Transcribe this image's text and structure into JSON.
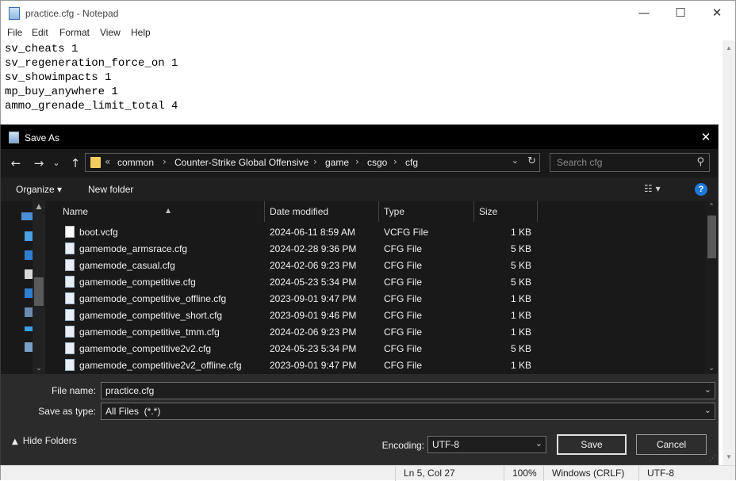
{
  "notepad": {
    "title": "practice.cfg - Notepad",
    "controls": {
      "minimize": "—",
      "maximize": "☐",
      "close": "✕"
    },
    "menu": [
      "File",
      "Edit",
      "Format",
      "View",
      "Help"
    ],
    "lines": [
      "sv_cheats 1",
      "sv_regeneration_force_on 1",
      "sv_showimpacts 1",
      "mp_buy_anywhere 1",
      "ammo_grenade_limit_total 4"
    ],
    "status": {
      "position": "Ln 5, Col 27",
      "zoom": "100%",
      "line_endings": "Windows (CRLF)",
      "encoding": "UTF-8"
    }
  },
  "dialog": {
    "title": "Save As",
    "close_glyph": "✕",
    "nav": {
      "back": "←",
      "forward": "→",
      "recent": "⌄",
      "up": "↑"
    },
    "address": {
      "overflow": "«",
      "crumbs": [
        "common",
        "Counter-Strike Global Offensive",
        "game",
        "csgo",
        "cfg"
      ]
    },
    "search_placeholder": "Search cfg",
    "toolbar": {
      "organize": "Organize ▾",
      "new_folder": "New folder",
      "help": "?"
    },
    "columns": {
      "name": "Name",
      "date": "Date modified",
      "type": "Type",
      "size": "Size"
    },
    "files": [
      {
        "name": "boot.vcfg",
        "date": "2024-06-11 8:59 AM",
        "type": "VCFG File",
        "size": "1 KB"
      },
      {
        "name": "gamemode_armsrace.cfg",
        "date": "2024-02-28 9:36 PM",
        "type": "CFG File",
        "size": "5 KB"
      },
      {
        "name": "gamemode_casual.cfg",
        "date": "2024-02-06 9:23 PM",
        "type": "CFG File",
        "size": "5 KB"
      },
      {
        "name": "gamemode_competitive.cfg",
        "date": "2024-05-23 5:34 PM",
        "type": "CFG File",
        "size": "5 KB"
      },
      {
        "name": "gamemode_competitive_offline.cfg",
        "date": "2023-09-01 9:47 PM",
        "type": "CFG File",
        "size": "1 KB"
      },
      {
        "name": "gamemode_competitive_short.cfg",
        "date": "2023-09-01 9:46 PM",
        "type": "CFG File",
        "size": "1 KB"
      },
      {
        "name": "gamemode_competitive_tmm.cfg",
        "date": "2024-02-06 9:23 PM",
        "type": "CFG File",
        "size": "1 KB"
      },
      {
        "name": "gamemode_competitive2v2.cfg",
        "date": "2024-05-23 5:34 PM",
        "type": "CFG File",
        "size": "5 KB"
      },
      {
        "name": "gamemode_competitive2v2_offline.cfg",
        "date": "2023-09-01 9:47 PM",
        "type": "CFG File",
        "size": "1 KB"
      }
    ],
    "file_name_label": "File name:",
    "file_name": "practice.cfg",
    "save_type_label": "Save as type:",
    "save_type": "All Files  (*.*)",
    "hide_folders": "Hide Folders",
    "encoding_label": "Encoding:",
    "encoding": "UTF-8",
    "save": "Save",
    "cancel": "Cancel"
  }
}
